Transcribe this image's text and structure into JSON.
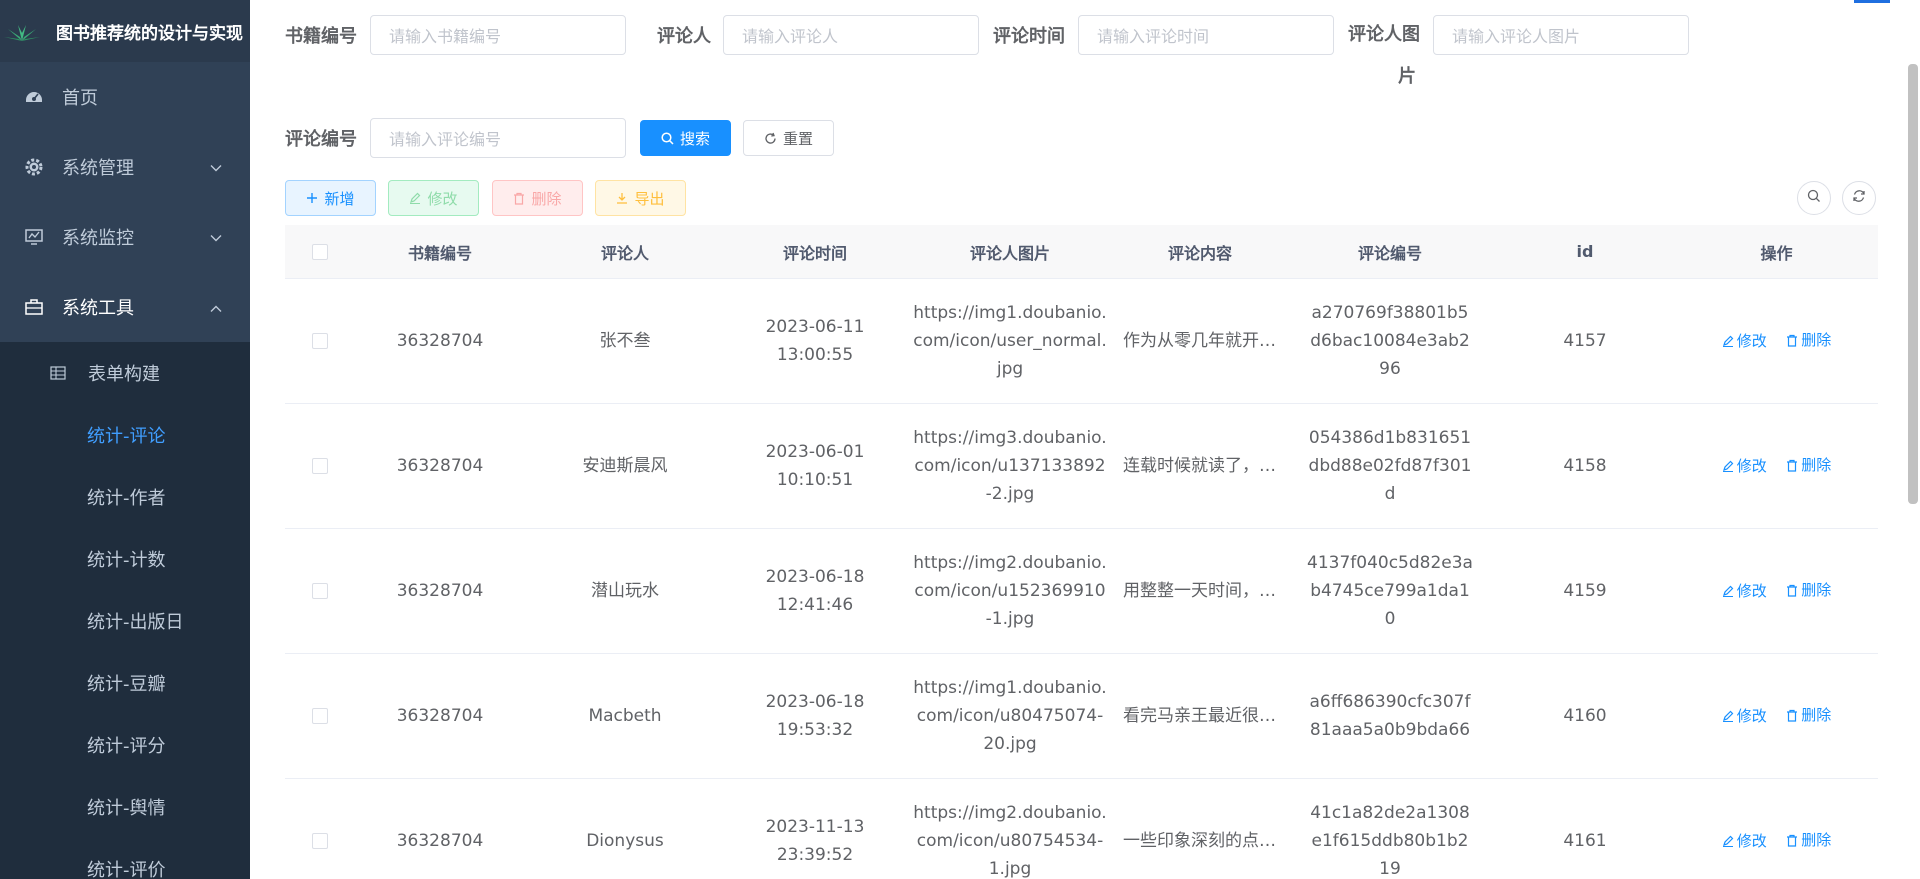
{
  "app": {
    "title": "图书推荐统的设计与实现"
  },
  "sidebar": {
    "items": [
      {
        "label": "首页"
      },
      {
        "label": "系统管理"
      },
      {
        "label": "系统监控"
      },
      {
        "label": "系统工具"
      }
    ],
    "subitems": [
      {
        "label": "表单构建"
      },
      {
        "label": "统计-评论"
      },
      {
        "label": "统计-作者"
      },
      {
        "label": "统计-计数"
      },
      {
        "label": "统计-出版日"
      },
      {
        "label": "统计-豆瓣"
      },
      {
        "label": "统计-评分"
      },
      {
        "label": "统计-舆情"
      },
      {
        "label": "统计-评价"
      }
    ]
  },
  "search": {
    "book_label": "书籍编号",
    "book_placeholder": "请输入书籍编号",
    "user_label": "评论人",
    "user_placeholder": "请输入评论人",
    "time_label": "评论时间",
    "time_placeholder": "请输入评论时间",
    "img_label_1": "评论人图",
    "img_label_2": "片",
    "img_placeholder": "请输入评论人图片",
    "code_label": "评论编号",
    "code_placeholder": "请输入评论编号",
    "search_btn": "搜索",
    "reset_btn": "重置"
  },
  "toolbar": {
    "add": "新增",
    "edit": "修改",
    "delete": "删除",
    "export": "导出"
  },
  "table": {
    "headers": {
      "book": "书籍编号",
      "user": "评论人",
      "time": "评论时间",
      "img": "评论人图片",
      "content": "评论内容",
      "code": "评论编号",
      "id": "id",
      "op": "操作"
    },
    "op_edit": "修改",
    "op_delete": "删除",
    "rows": [
      {
        "book": "36328704",
        "user": "张不叁",
        "time": "2023-06-11 13:00:55",
        "img": "https://img1.doubanio.com/icon/user_normal.jpg",
        "content": "作为从零几年就开始追更的书迷",
        "code": "a270769f38801b5d6bac10084e3ab296",
        "id": "4157"
      },
      {
        "book": "36328704",
        "user": "安迪斯晨风",
        "time": "2023-06-01 10:10:51",
        "img": "https://img3.doubanio.com/icon/u137133892-2.jpg",
        "content": "连载时候就读了，很多年过去了",
        "code": "054386d1b831651dbd88e02fd87f301d",
        "id": "4158"
      },
      {
        "book": "36328704",
        "user": "潜山玩水",
        "time": "2023-06-18 12:41:46",
        "img": "https://img2.doubanio.com/icon/u152369910-1.jpg",
        "content": "用整整一天时间，一口气读完",
        "code": "4137f040c5d82e3ab4745ce799a1da10",
        "id": "4159"
      },
      {
        "book": "36328704",
        "user": "Macbeth",
        "time": "2023-06-18 19:53:32",
        "img": "https://img1.doubanio.com/icon/u80475074-20.jpg",
        "content": "看完马亲王最近很多作品",
        "code": "a6ff686390cfc307f81aaa5a0b9bda66",
        "id": "4160"
      },
      {
        "book": "36328704",
        "user": "Dionysus",
        "time": "2023-11-13 23:39:52",
        "img": "https://img2.doubanio.com/icon/u80754534-1.jpg",
        "content": "一些印象深刻的点和细节",
        "code": "41c1a82de2a1308e1f615ddb80b1b219",
        "id": "4161"
      }
    ]
  }
}
